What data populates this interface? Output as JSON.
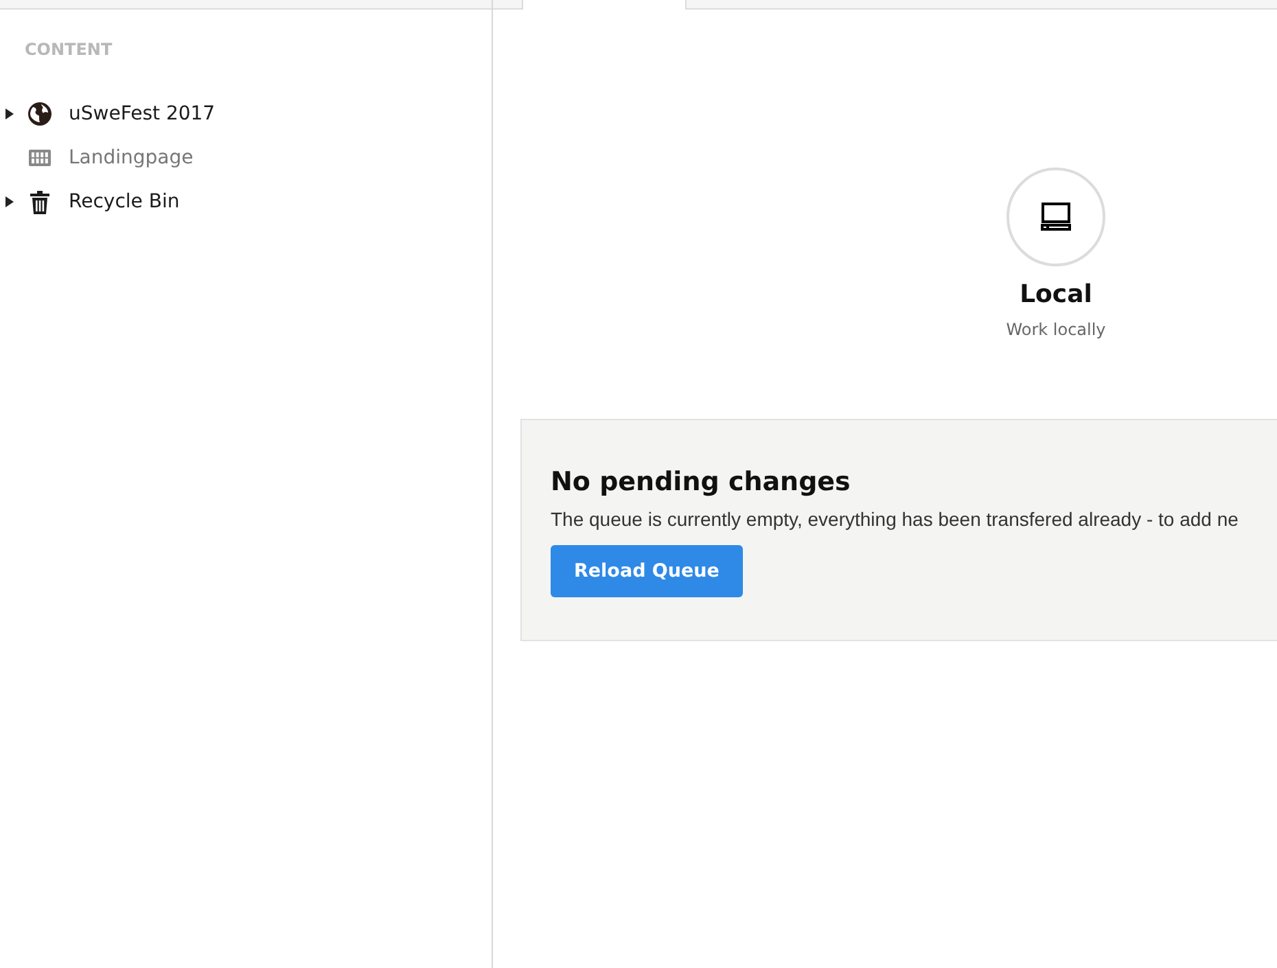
{
  "sidebar": {
    "heading": "CONTENT",
    "tree": [
      {
        "label": "uSweFest 2017",
        "kind": "site",
        "has_children": true,
        "published": true
      },
      {
        "label": "Landingpage",
        "kind": "page",
        "has_children": false,
        "published": false
      },
      {
        "label": "Recycle Bin",
        "kind": "bin",
        "has_children": true,
        "published": true
      }
    ]
  },
  "target": {
    "title": "Local",
    "subtitle": "Work locally"
  },
  "queue": {
    "title": "No pending changes",
    "message": "The queue is currently empty, everything has been transfered already - to add ne",
    "button": "Reload Queue"
  }
}
